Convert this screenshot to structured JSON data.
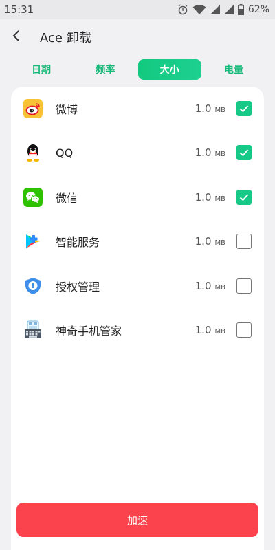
{
  "status_bar": {
    "time": "15:31",
    "battery": "62%",
    "icons": [
      "alarm-icon",
      "wifi-icon",
      "signal-icon",
      "signal-icon",
      "battery-icon"
    ]
  },
  "header": {
    "title": "Ace 卸载",
    "back_icon": "back-arrow-icon"
  },
  "tabs": [
    {
      "label": "日期",
      "active": false
    },
    {
      "label": "频率",
      "active": false
    },
    {
      "label": "大小",
      "active": true
    },
    {
      "label": "电量",
      "active": false
    }
  ],
  "apps": [
    {
      "name": "微博",
      "size": "1.0",
      "unit": "MB",
      "checked": true,
      "icon": "weibo-icon"
    },
    {
      "name": "QQ",
      "size": "1.0",
      "unit": "MB",
      "checked": true,
      "icon": "qq-icon"
    },
    {
      "name": "微信",
      "size": "1.0",
      "unit": "MB",
      "checked": true,
      "icon": "wechat-icon"
    },
    {
      "name": "智能服务",
      "size": "1.0",
      "unit": "MB",
      "checked": false,
      "icon": "smart-service-icon"
    },
    {
      "name": "授权管理",
      "size": "1.0",
      "unit": "MB",
      "checked": false,
      "icon": "auth-manager-icon"
    },
    {
      "name": "神奇手机管家",
      "size": "1.0",
      "unit": "MB",
      "checked": false,
      "icon": "phone-manager-icon"
    }
  ],
  "boost_button": {
    "label": "加速"
  },
  "colors": {
    "accent": "#17c987",
    "boost": "#fa434c",
    "background": "#f1f1f3"
  }
}
